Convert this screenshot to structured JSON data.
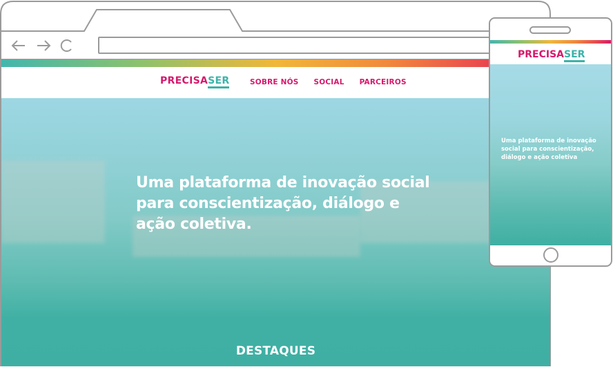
{
  "desktop": {
    "brand": {
      "part1": "PRECISA",
      "part2": "SER"
    },
    "menu": [
      {
        "label": "SOBRE NÓS"
      },
      {
        "label": "SOCIAL"
      },
      {
        "label": "PARCEIROS"
      }
    ],
    "hero_text": "Uma plataforma de inovação social para conscientização, diálogo e ação coletiva.",
    "section_title": "DESTAQUES"
  },
  "mobile": {
    "brand": {
      "part1": "PRECISA",
      "part2": "SER"
    },
    "hero_text": "Uma plataforma de inovação social para conscientização, diálogo e ação coletiva"
  },
  "colors": {
    "brand_pink": "#d6196d",
    "brand_teal": "#3bb3a9",
    "frame_gray": "#9a9a9a"
  },
  "icons": [
    "back-arrow-icon",
    "forward-arrow-icon",
    "reload-icon"
  ]
}
